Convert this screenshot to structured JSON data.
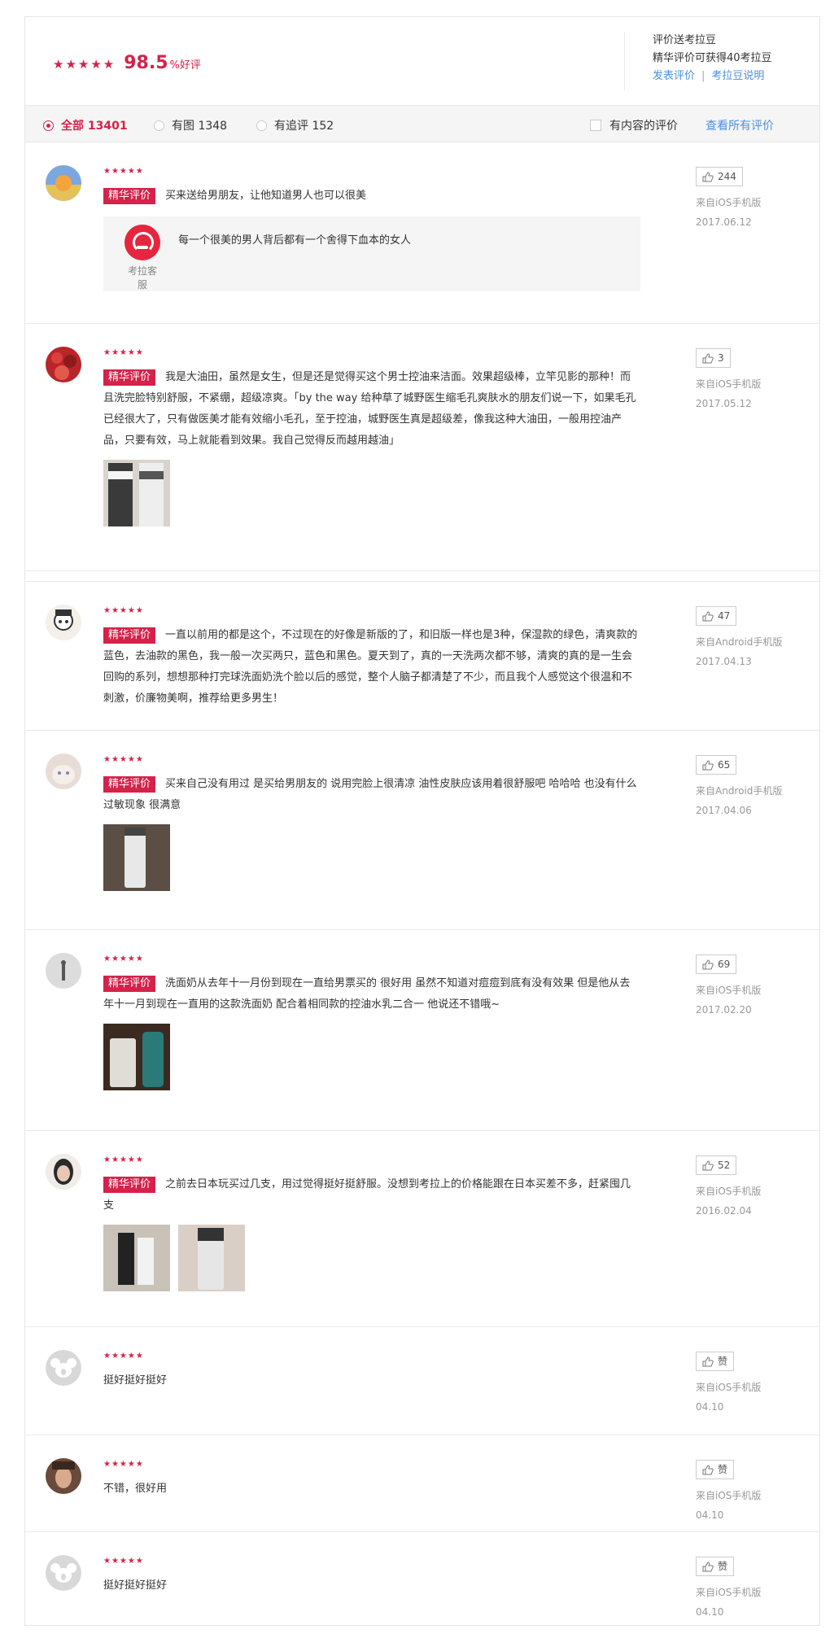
{
  "summary": {
    "stars": "★★★★★",
    "score": "98.5",
    "pct_label": "%好评",
    "right_line1": "评价送考拉豆",
    "right_line2": "精华评价可获得40考拉豆",
    "link_post": "发表评价",
    "link_sep": "|",
    "link_explain": "考拉豆说明"
  },
  "filter": {
    "all": "全部 13401",
    "with_image": "有图 1348",
    "with_followup": "有追评 152",
    "with_content": "有内容的评价",
    "view_all": "查看所有评价"
  },
  "colors": {
    "accent": "#d4224a",
    "link": "#4a90e2"
  },
  "tag_label": "精华评价",
  "service": {
    "name": "考拉客服",
    "icon": "headset-icon"
  },
  "reviews": [
    {
      "stars": "★★★★★",
      "tag": true,
      "text": "买来送给男朋友，让他知道男人也可以很美",
      "reply": "每一个很美的男人背后都有一个舍得下血本的女人",
      "likes": "244",
      "source": "来自iOS手机版",
      "date": "2017.06.12"
    },
    {
      "stars": "★★★★★",
      "tag": true,
      "text": "我是大油田，虽然是女生，但是还是觉得买这个男士控油来洁面。效果超级棒，立竿见影的那种！而且洗完脸特别舒服，不紧绷，超级凉爽。「by the way 给种草了城野医生缩毛孔爽肤水的朋友们说一下，如果毛孔已经很大了，只有做医美才能有效缩小毛孔，至于控油，城野医生真是超级差，像我这种大油田，一般用控油产品，只要有效，马上就能看到效果。我自己觉得反而越用越油」",
      "likes": "3",
      "source": "来自iOS手机版",
      "date": "2017.05.12"
    },
    {
      "stars": "★★★★★",
      "tag": true,
      "text": "一直以前用的都是这个，不过现在的好像是新版的了，和旧版一样也是3种，保湿款的绿色，清爽款的蓝色，去油款的黑色，我一般一次买两只，蓝色和黑色。夏天到了，真的一天洗两次都不够，清爽的真的是一生会回购的系列，想想那种打完球洗面奶洗个脸以后的感觉，整个人脑子都清楚了不少，而且我个人感觉这个很温和不刺激，价廉物美啊，推荐给更多男生！",
      "likes": "47",
      "source": "来自Android手机版",
      "date": "2017.04.13"
    },
    {
      "stars": "★★★★★",
      "tag": true,
      "text": "买来自己没有用过 是买给男朋友的 说用完脸上很清凉 油性皮肤应该用着很舒服吧 哈哈哈 也没有什么过敏现象 很满意",
      "likes": "65",
      "source": "来自Android手机版",
      "date": "2017.04.06"
    },
    {
      "stars": "★★★★★",
      "tag": true,
      "text": "洗面奶从去年十一月份到现在一直给男票买的 很好用 虽然不知道对痘痘到底有没有效果 但是他从去年十一月到现在一直用的这款洗面奶 配合着相同款的控油水乳二合一 他说还不错哦~",
      "likes": "69",
      "source": "来自iOS手机版",
      "date": "2017.02.20"
    },
    {
      "stars": "★★★★★",
      "tag": true,
      "text": "之前去日本玩买过几支，用过觉得挺好挺舒服。没想到考拉上的价格能跟在日本买差不多，赶紧囤几支",
      "likes": "52",
      "source": "来自iOS手机版",
      "date": "2016.02.04"
    },
    {
      "stars": "★★★★★",
      "tag": false,
      "text": "挺好挺好挺好",
      "likes": "赞",
      "source": "来自iOS手机版",
      "date": "04.10"
    },
    {
      "stars": "★★★★★",
      "tag": false,
      "text": "不错，很好用",
      "likes": "赞",
      "source": "来自iOS手机版",
      "date": "04.10"
    },
    {
      "stars": "★★★★★",
      "tag": false,
      "text": "挺好挺好挺好",
      "likes": "赞",
      "source": "来自iOS手机版",
      "date": "04.10"
    }
  ]
}
